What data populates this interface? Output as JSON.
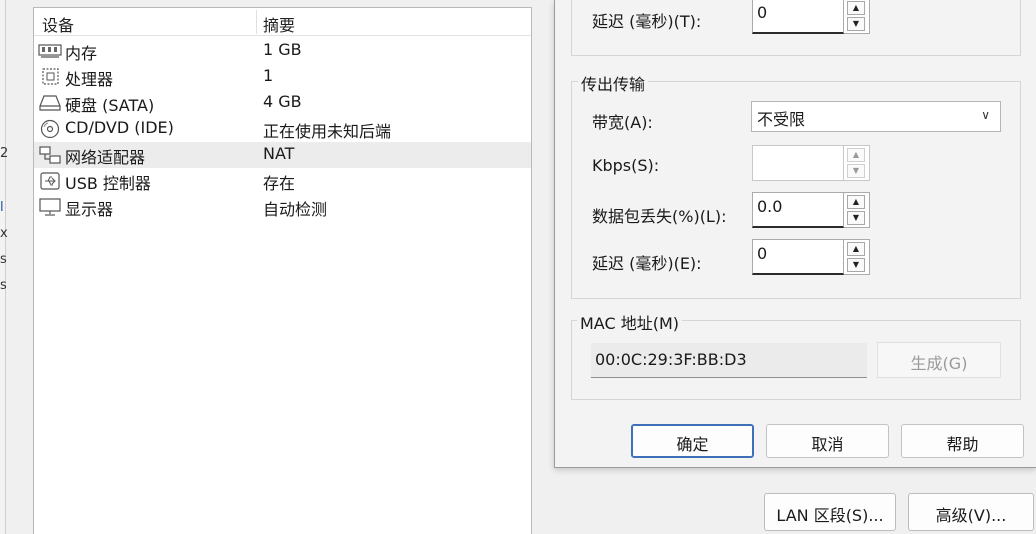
{
  "device_list": {
    "headers": {
      "device": "设备",
      "summary": "摘要"
    },
    "rows": [
      {
        "icon": "memory-icon",
        "name": "内存",
        "summary": "1 GB"
      },
      {
        "icon": "processor-icon",
        "name": "处理器",
        "summary": "1"
      },
      {
        "icon": "harddisk-icon",
        "name": "硬盘 (SATA)",
        "summary": "4 GB"
      },
      {
        "icon": "cd-dvd-icon",
        "name": "CD/DVD (IDE)",
        "summary": "正在使用未知后端"
      },
      {
        "icon": "network-adapter-icon",
        "name": "网络适配器",
        "summary": "NAT",
        "selected": true
      },
      {
        "icon": "usb-icon",
        "name": "USB 控制器",
        "summary": "存在"
      },
      {
        "icon": "display-icon",
        "name": "显示器",
        "summary": "自动检测"
      }
    ]
  },
  "dialog": {
    "incoming": {
      "latency_label": "延迟 (毫秒)(T):",
      "latency_value": "0"
    },
    "outgoing": {
      "title": "传出传输",
      "bandwidth_label": "带宽(A):",
      "bandwidth_value": "不受限",
      "kbps_label": "Kbps(S):",
      "kbps_value": "",
      "packet_loss_label": "数据包丢失(%)(L):",
      "packet_loss_value": "0.0",
      "latency_label": "延迟 (毫秒)(E):",
      "latency_value": "0"
    },
    "mac": {
      "title": "MAC 地址(M)",
      "value": "00:0C:29:3F:BB:D3",
      "generate_label": "生成(G)"
    },
    "buttons": {
      "ok": "确定",
      "cancel": "取消",
      "help": "帮助"
    }
  },
  "bottom_buttons": {
    "lan_segment": "LAN 区段(S)...",
    "advanced": "高级(V)..."
  },
  "colors": {
    "selected_row": "#ececec",
    "primary_border": "#3f6fb8",
    "background": "#f0f0f0"
  }
}
